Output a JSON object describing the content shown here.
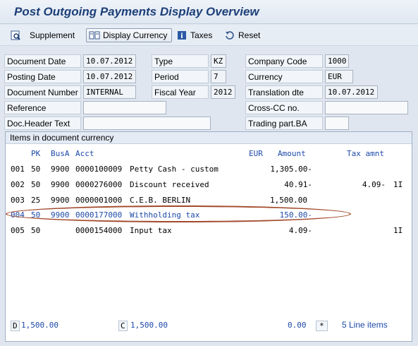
{
  "window": {
    "title": "Post Outgoing Payments Display Overview"
  },
  "toolbar": {
    "supplement": "Supplement",
    "display_currency": "Display Currency",
    "taxes": "Taxes",
    "reset": "Reset"
  },
  "header": {
    "document_date": {
      "label": "Document Date",
      "value": "10.07.2012"
    },
    "type": {
      "label": "Type",
      "value": "KZ"
    },
    "company_code": {
      "label": "Company Code",
      "value": "1000"
    },
    "posting_date": {
      "label": "Posting Date",
      "value": "10.07.2012"
    },
    "period": {
      "label": "Period",
      "value": "7"
    },
    "currency": {
      "label": "Currency",
      "value": "EUR"
    },
    "document_number": {
      "label": "Document Number",
      "value": "INTERNAL"
    },
    "fiscal_year": {
      "label": "Fiscal Year",
      "value": "2012"
    },
    "translation_dte": {
      "label": "Translation dte",
      "value": "10.07.2012"
    },
    "reference": {
      "label": "Reference",
      "value": ""
    },
    "cross_cc": {
      "label": "Cross-CC no.",
      "value": ""
    },
    "doc_header_text": {
      "label": "Doc.Header Text",
      "value": ""
    },
    "trading_part": {
      "label": "Trading part.BA",
      "value": ""
    }
  },
  "items": {
    "title": "Items in document currency",
    "columns": {
      "pk": "PK",
      "busa": "BusA",
      "acct": "Acct",
      "currency": "EUR",
      "amount": "Amount",
      "tax": "Tax amnt"
    },
    "rows": [
      {
        "line": "001",
        "pk": "50",
        "busa": "9900",
        "acct": "0000100009",
        "text": "Petty Cash - custom",
        "amount": "1,305.00-",
        "tax": "",
        "code": ""
      },
      {
        "line": "002",
        "pk": "50",
        "busa": "9900",
        "acct": "0000276000",
        "text": "Discount received",
        "amount": "40.91-",
        "tax": "4.09-",
        "code": "1I"
      },
      {
        "line": "003",
        "pk": "25",
        "busa": "9900",
        "acct": "0000001000",
        "text": "C.E.B. BERLIN",
        "amount": "1,500.00",
        "tax": "",
        "code": ""
      },
      {
        "line": "004",
        "pk": "50",
        "busa": "9900",
        "acct": "0000177000",
        "text": "Withholding tax",
        "amount": "150.00-",
        "tax": "",
        "code": ""
      },
      {
        "line": "005",
        "pk": "50",
        "busa": "",
        "acct": "0000154000",
        "text": "Input tax",
        "amount": "4.09-",
        "tax": "",
        "code": "1I"
      }
    ],
    "footer": {
      "d_label": "D",
      "d_value": "1,500.00",
      "c_label": "C",
      "c_value": "1,500.00",
      "balance": "0.00",
      "star": "*",
      "line_items": "5 Line items"
    }
  }
}
